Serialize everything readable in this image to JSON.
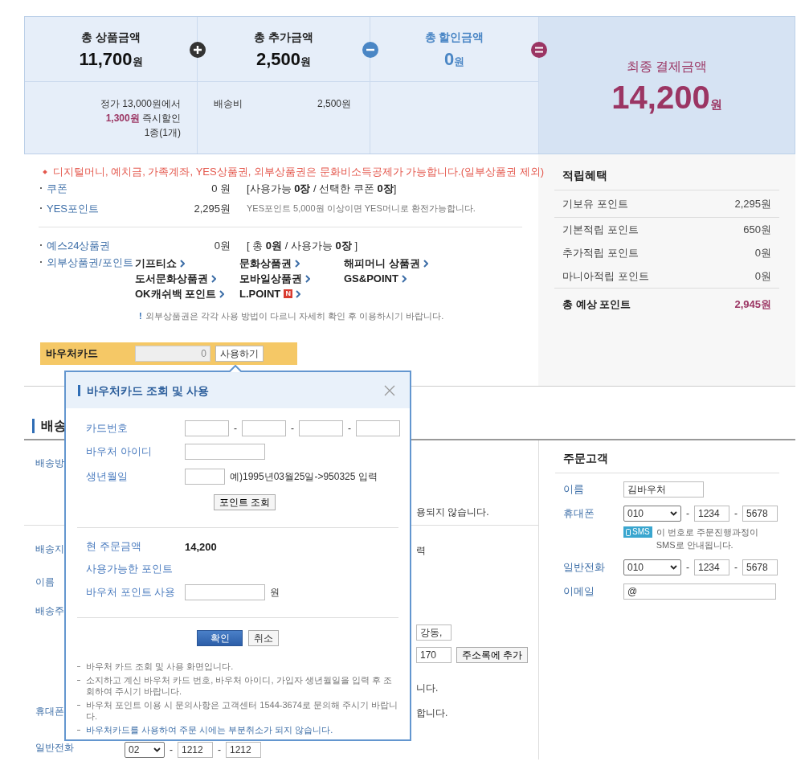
{
  "summary": {
    "items": [
      {
        "kind": "plain",
        "label": "총 상품금액",
        "amount": "11,700",
        "unit": "원"
      },
      {
        "kind": "plain",
        "label": "총 추가금액",
        "amount": "2,500",
        "unit": "원"
      },
      {
        "kind": "discount",
        "label": "총 할인금액",
        "amount": "0",
        "unit": "원"
      }
    ],
    "product_detail": [
      "정가 13,000원에서",
      "**1,300원** 즉시할인",
      "1종(1개)"
    ],
    "extra_detail": {
      "label": "배송비",
      "value": "2,500원"
    },
    "final": {
      "label": "최종 결제금액",
      "amount": "14,200",
      "unit": "원"
    }
  },
  "payment": {
    "notice": "디지털머니, 예치금, 가족계좌, YES상품권, 외부상품권은 문화비소득공제가 가능합니다.(일부상품권 제외)",
    "rows": [
      {
        "kind": "main",
        "label": "쿠폰",
        "value": "0 원",
        "note": "[사용가능 **0장** / 선택한 쿠폰 **0장**]"
      },
      {
        "kind": "small",
        "label": "YES포인트",
        "value": "2,295원",
        "note": "YES포인트 5,000원 이상이면 YES머니로 환전가능합니다."
      }
    ],
    "gift_rows": [
      {
        "label": "예스24상품권",
        "value": "0원",
        "note": "[ 총 **0원** / 사용가능 **0장** ]"
      }
    ],
    "external": {
      "label": "외부상품권/포인트",
      "links": [
        {
          "text": "기프티쇼"
        },
        {
          "text": "문화상품권"
        },
        {
          "text": "해피머니 상품권"
        },
        {
          "text": "도서문화상품권"
        },
        {
          "text": "모바일상품권"
        },
        {
          "text": "GS&POINT"
        },
        {
          "text": "OK캐쉬백 포인트"
        },
        {
          "text": "L.POINT",
          "badge": "N"
        }
      ]
    },
    "warning": {
      "mark": "!",
      "text": "외부상품권은 각각 사용 방법이 다르니 자세히 확인 후 이용하시기 바랍니다."
    },
    "voucher": {
      "label": "바우처카드",
      "value": "0",
      "button": "사용하기"
    }
  },
  "benefits": {
    "title": "적립혜택",
    "rows": [
      {
        "kind": "held",
        "label": "기보유 포인트",
        "value": "2,295원"
      },
      {
        "kind": "earn",
        "label": "기본적립 포인트",
        "value": "650원"
      },
      {
        "kind": "earn",
        "label": "추가적립 포인트",
        "value": "0원"
      },
      {
        "kind": "earn",
        "label": "마니아적립 포인트",
        "value": "0원"
      },
      {
        "kind": "total",
        "label": "총 예상 포인트",
        "value": "2,945원"
      }
    ]
  },
  "shipping": {
    "title": "배송",
    "rows": [
      {
        "kind": "covered",
        "label": "배송방",
        "lines": [
          [
            {
              "kind": "text",
              "text": "용되지 않습니다."
            }
          ]
        ]
      },
      {
        "kind": "covered",
        "label": "배송지",
        "lines": [
          [
            {
              "kind": "text",
              "text": "력"
            }
          ]
        ]
      },
      {
        "kind": "covered",
        "label": "이름"
      },
      {
        "kind": "covered",
        "label": "배송주",
        "lines": [
          [
            {
              "kind": "small",
              "text": "강동,"
            }
          ],
          [
            {
              "kind": "small",
              "text": "170"
            },
            {
              "kind": "button",
              "text": "주소록에 추가"
            }
          ],
          [
            {
              "kind": "text",
              "text": "니다."
            }
          ]
        ]
      },
      {
        "kind": "covered",
        "label": "휴대폰",
        "lines": [
          [
            {
              "kind": "text",
              "text": "합니다."
            }
          ]
        ]
      },
      {
        "kind": "open",
        "label": "일반전화",
        "lines": [
          [
            {
              "kind": "mini_select",
              "text": "02"
            },
            {
              "kind": "text",
              "text": "-"
            },
            {
              "kind": "small",
              "text": "1212"
            },
            {
              "kind": "text",
              "text": "-"
            },
            {
              "kind": "small",
              "text": "1212"
            }
          ]
        ]
      }
    ]
  },
  "customer": {
    "title": "주문고객",
    "rows": [
      {
        "label": "이름",
        "parts": [
          {
            "kind": "field",
            "text": "김바우처"
          }
        ]
      },
      {
        "label": "휴대폰",
        "parts": [
          {
            "kind": "select",
            "text": "010"
          },
          {
            "kind": "text",
            "text": "-"
          },
          {
            "kind": "small",
            "text": "1234"
          },
          {
            "kind": "text",
            "text": "-"
          },
          {
            "kind": "small",
            "text": "5678"
          }
        ],
        "sms": {
          "badge": "SMS",
          "text": "이 번호로 주문진행과정이 SMS로 안내됩니다."
        }
      },
      {
        "label": "일반전화",
        "parts": [
          {
            "kind": "select",
            "text": "010"
          },
          {
            "kind": "text",
            "text": "-"
          },
          {
            "kind": "small",
            "text": "1234"
          },
          {
            "kind": "text",
            "text": "-"
          },
          {
            "kind": "small",
            "text": "5678"
          }
        ]
      },
      {
        "label": "이메일",
        "parts": [
          {
            "kind": "wide",
            "text": "@"
          }
        ]
      }
    ]
  },
  "popup": {
    "title": "바우처카드 조회 및 사용",
    "rows": [
      {
        "label": "카드번호",
        "parts": [
          {
            "kind": "input"
          },
          {
            "kind": "text",
            "text": "-"
          },
          {
            "kind": "input"
          },
          {
            "kind": "text",
            "text": "-"
          },
          {
            "kind": "input"
          },
          {
            "kind": "text",
            "text": "-"
          },
          {
            "kind": "input"
          }
        ]
      },
      {
        "label": "바우처 아이디",
        "parts": [
          {
            "kind": "field"
          }
        ]
      },
      {
        "label": "생년월일",
        "parts": [
          {
            "kind": "short"
          },
          {
            "kind": "text",
            "text": "예)1995년03월25일->950325 입력"
          }
        ]
      }
    ],
    "lookup_button": "포인트 조회",
    "info_rows": [
      {
        "label": "현 주문금액",
        "parts": [
          {
            "kind": "value",
            "text": "14,200"
          }
        ]
      },
      {
        "label": "사용가능한 포인트"
      },
      {
        "label": "바우처 포인트 사용",
        "parts": [
          {
            "kind": "field"
          },
          {
            "kind": "text",
            "text": "원"
          }
        ]
      }
    ],
    "buttons": [
      {
        "kind": "primary",
        "label": "확인"
      },
      {
        "kind": "normal",
        "label": "취소"
      }
    ],
    "notes": [
      {
        "kind": "normal",
        "text": "바우처 카드 조회 및 사용 화면입니다."
      },
      {
        "kind": "normal",
        "text": "소지하고 계신 바우처 카드 번호, 바우처 아이디, 가입자 생년월일을 입력 후 조회하여 주시기 바랍니다."
      },
      {
        "kind": "normal",
        "text": "바우처 포인트 이용 시 문의사항은 고객센터 1544-3674로 문의해 주시기 바랍니다."
      },
      {
        "kind": "highlight",
        "text": "바우처카드를 사용하여 주문 시에는 부분취소가 되지 않습니다."
      }
    ]
  }
}
